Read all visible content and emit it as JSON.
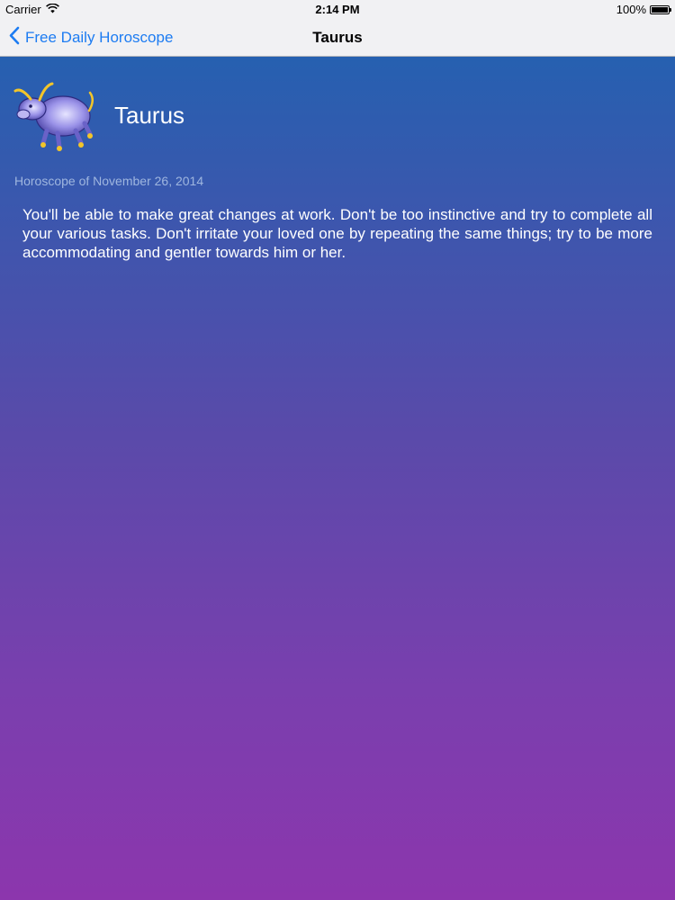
{
  "status_bar": {
    "carrier": "Carrier",
    "time": "2:14 PM",
    "battery": "100%",
    "battery_level": 1.0
  },
  "nav_bar": {
    "back_label": "Free Daily Horoscope",
    "title": "Taurus"
  },
  "content": {
    "sign_name": "Taurus",
    "sign_icon": "taurus-bull-icon",
    "date_line": "Horoscope of November 26, 2014",
    "text": "You'll be able to make great changes at work. Don't be too instinctive and try to complete all your various tasks. Don't irritate your loved one by repeating the same things; try to be more accommodating and gentler towards him or her."
  },
  "colors": {
    "nav_background": "#f1f1f3",
    "accent": "#1d7cf2",
    "gradient_top": "#2660b0",
    "gradient_bottom": "#8c36ad",
    "date_text": "#9fb6df"
  }
}
